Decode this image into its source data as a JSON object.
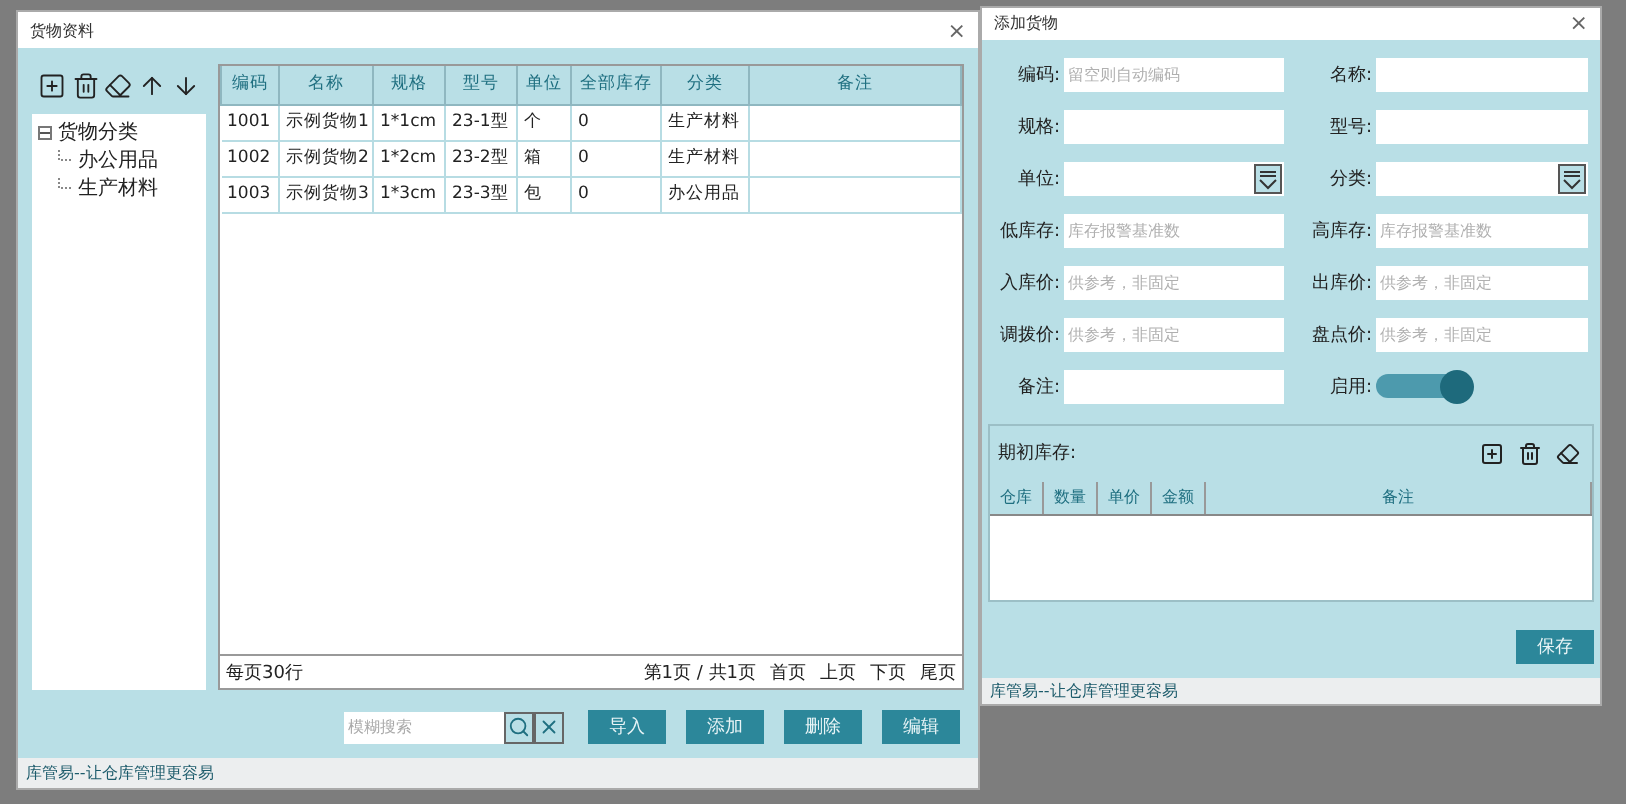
{
  "main_window": {
    "title": "货物资料",
    "close": "×",
    "tree": {
      "label": "货物分类",
      "expanded": true,
      "children": [
        {
          "label": "办公用品"
        },
        {
          "label": "生产材料"
        }
      ]
    },
    "table": {
      "columns": [
        "编码",
        "名称",
        "规格",
        "型号",
        "单位",
        "全部库存",
        "分类",
        "备注"
      ],
      "rows": [
        [
          "1001",
          "示例货物1",
          "1*1cm",
          "23-1型",
          "个",
          "0",
          "生产材料"
        ],
        [
          "1002",
          "示例货物2",
          "1*2cm",
          "23-2型",
          "箱",
          "0",
          "生产材料"
        ],
        [
          "1003",
          "示例货物3",
          "1*3cm",
          "23-3型",
          "包",
          "0",
          "办公用品"
        ]
      ]
    },
    "footer": {
      "page_size": "每页30行",
      "page_info": "第1页 / 共1页",
      "nav": [
        "首页",
        "上页",
        "下页",
        "尾页"
      ]
    },
    "search": {
      "placeholder": "模糊搜索"
    },
    "buttons": [
      "导入",
      "添加",
      "删除",
      "编辑"
    ],
    "status_bar": "库管易--让仓库管理更容易"
  },
  "add_window": {
    "title": "添加货物",
    "close": "×",
    "fields": [
      {
        "label": "编码:",
        "kind": "text",
        "placeholder": "留空则自动编码"
      },
      {
        "label": "名称:",
        "kind": "text"
      },
      {
        "label": "规格:",
        "kind": "text"
      },
      {
        "label": "型号:",
        "kind": "text"
      },
      {
        "label": "单位:",
        "kind": "select"
      },
      {
        "label": "分类:",
        "kind": "select"
      },
      {
        "label": "低库存:",
        "kind": "text",
        "placeholder": "库存报警基准数"
      },
      {
        "label": "高库存:",
        "kind": "text",
        "placeholder": "库存报警基准数"
      },
      {
        "label": "入库价:",
        "kind": "text",
        "placeholder": "供参考，非固定"
      },
      {
        "label": "出库价:",
        "kind": "text",
        "placeholder": "供参考，非固定"
      },
      {
        "label": "调拨价:",
        "kind": "text",
        "placeholder": "供参考，非固定"
      },
      {
        "label": "盘点价:",
        "kind": "text",
        "placeholder": "供参考，非固定"
      },
      {
        "label": "备注:",
        "kind": "text"
      },
      {
        "label": "启用:",
        "kind": "toggle",
        "on": true
      }
    ],
    "initial_stock": {
      "label": "期初库存:",
      "columns": [
        "仓库",
        "数量",
        "单价",
        "金额",
        "备注"
      ]
    },
    "save_button": "保存",
    "status_bar": "库管易--让仓库管理更容易"
  }
}
